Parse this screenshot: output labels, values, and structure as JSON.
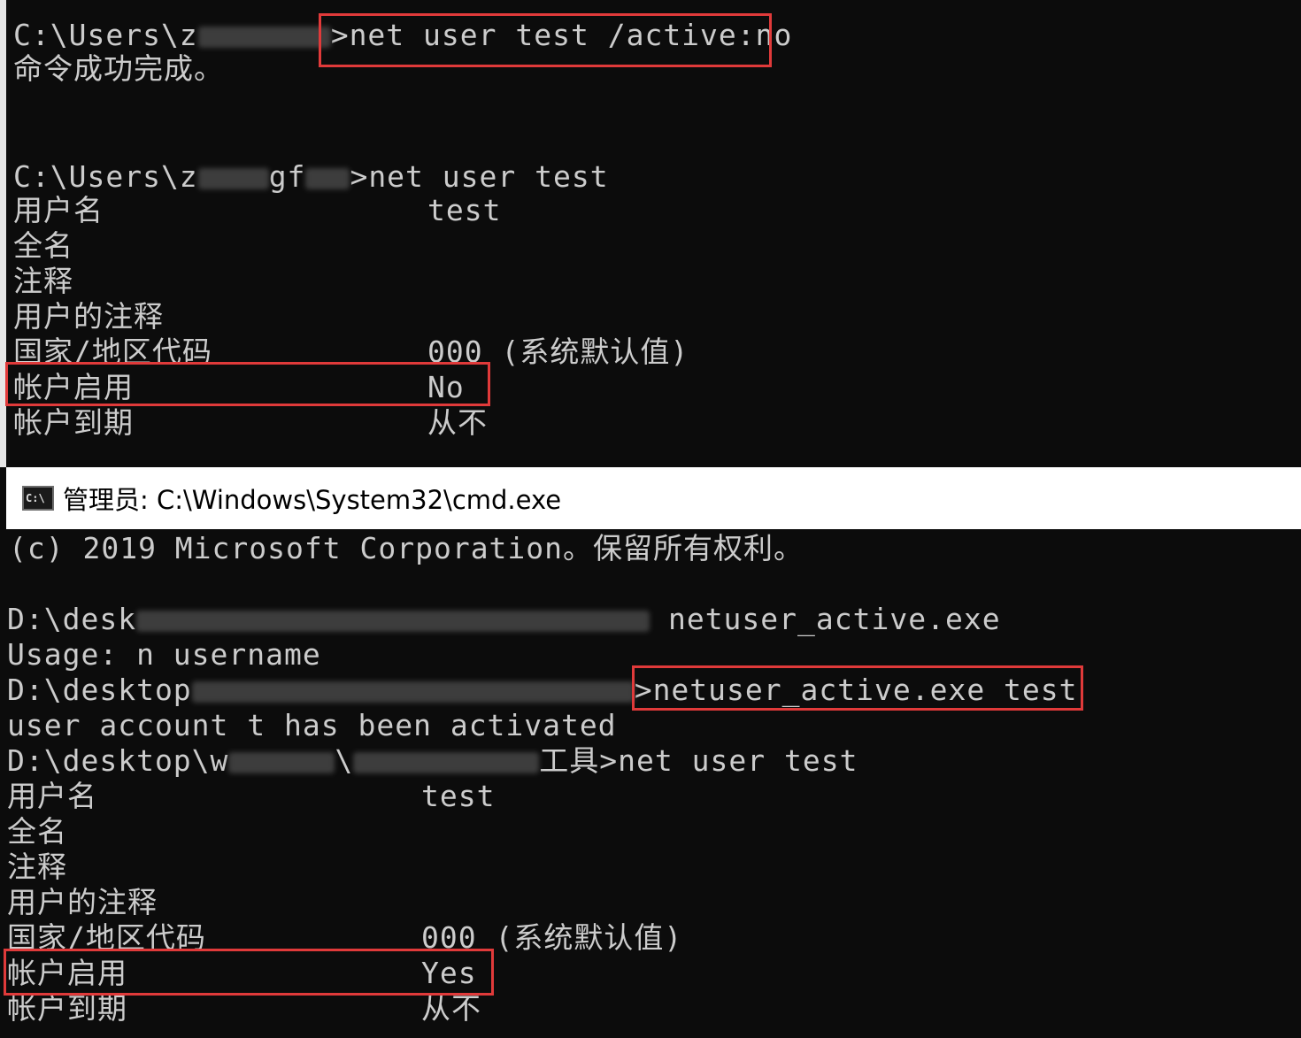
{
  "top_terminal": {
    "line1_prompt_prefix": "C:\\Users\\z",
    "line1_prompt_suffix": ">",
    "line1_command": "net user test /active:no",
    "line2": "命令成功完成。",
    "line3_prompt_prefix": "C:\\Users\\z",
    "line3_prompt_mid": "gf",
    "line3_prompt_suffix": ">",
    "line3_command": "net user test",
    "fields": [
      {
        "label": "用户名",
        "value": "test"
      },
      {
        "label": "全名",
        "value": ""
      },
      {
        "label": "注释",
        "value": ""
      },
      {
        "label": "用户的注释",
        "value": ""
      },
      {
        "label": "国家/地区代码",
        "value": "000 (系统默认值)"
      },
      {
        "label": "帐户启用",
        "value": "No"
      },
      {
        "label": "帐户到期",
        "value": "从不"
      }
    ]
  },
  "window": {
    "icon_text": "C:\\",
    "title": "管理员: C:\\Windows\\System32\\cmd.exe"
  },
  "bottom_terminal": {
    "copyright": "(c) 2019 Microsoft Corporation。保留所有权利。",
    "prompt1_prefix": "D:\\desk",
    "prompt1_command": "netuser_active.exe",
    "usage": "Usage: n username",
    "prompt2_prefix": "D:\\desktop",
    "prompt2_suffix": ">",
    "prompt2_command": "netuser_active.exe test",
    "activated": "user account t has been activated",
    "prompt3_prefix": "D:\\desktop\\w",
    "prompt3_mid": "\\",
    "prompt3_tail": "工具>",
    "prompt3_command": "net user test",
    "fields": [
      {
        "label": "用户名",
        "value": "test"
      },
      {
        "label": "全名",
        "value": ""
      },
      {
        "label": "注释",
        "value": ""
      },
      {
        "label": "用户的注释",
        "value": ""
      },
      {
        "label": "国家/地区代码",
        "value": "000 (系统默认值)"
      },
      {
        "label": "帐户启用",
        "value": "Yes"
      },
      {
        "label": "帐户到期",
        "value": "从不"
      }
    ]
  },
  "colors": {
    "terminal_bg": "#0c0c0c",
    "terminal_text": "#cccccc",
    "highlight": "#e03a3a"
  }
}
